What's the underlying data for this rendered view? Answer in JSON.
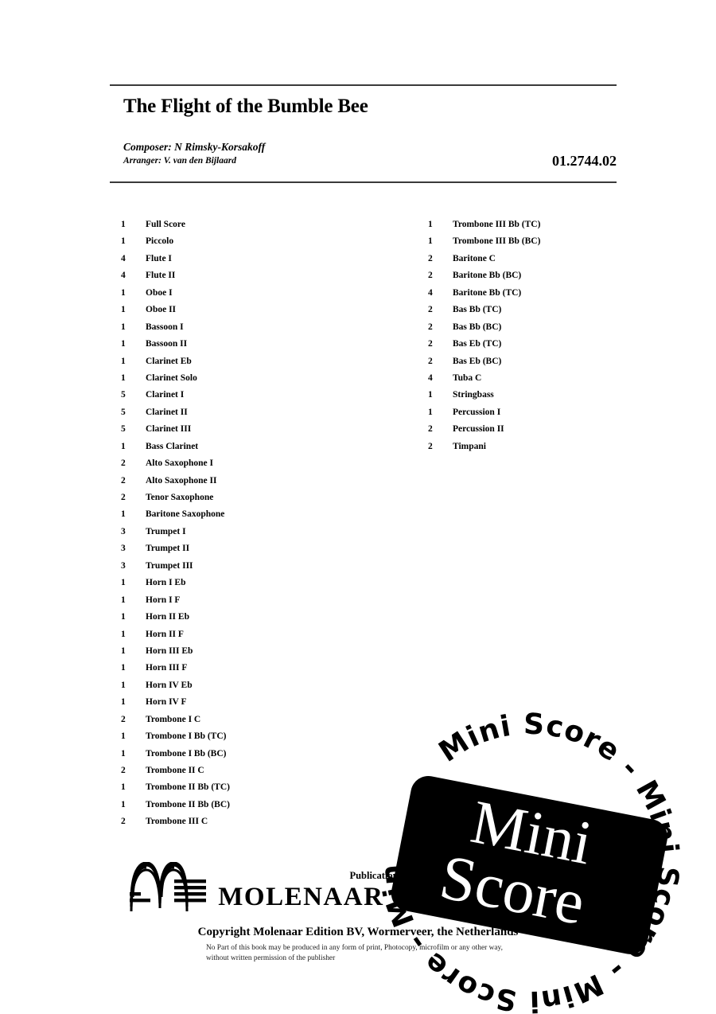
{
  "header": {
    "title": "The Flight of the Bumble Bee",
    "composer_label": "Composer: N Rimsky-Korsakoff",
    "arranger_label": "Arranger: V. van den Bijlaard",
    "catalog_number": "01.2744.02"
  },
  "instrumentation": {
    "left_column": [
      {
        "qty": "1",
        "name": "Full Score"
      },
      {
        "qty": "1",
        "name": "Piccolo"
      },
      {
        "qty": "4",
        "name": "Flute I"
      },
      {
        "qty": "4",
        "name": "Flute II"
      },
      {
        "qty": "1",
        "name": "Oboe I"
      },
      {
        "qty": "1",
        "name": "Oboe II"
      },
      {
        "qty": "1",
        "name": "Bassoon I"
      },
      {
        "qty": "1",
        "name": "Bassoon II"
      },
      {
        "qty": "1",
        "name": "Clarinet Eb"
      },
      {
        "qty": "1",
        "name": "Clarinet Solo"
      },
      {
        "qty": "5",
        "name": "Clarinet I"
      },
      {
        "qty": "5",
        "name": "Clarinet II"
      },
      {
        "qty": "5",
        "name": "Clarinet III"
      },
      {
        "qty": "1",
        "name": "Bass Clarinet"
      },
      {
        "qty": "2",
        "name": "Alto Saxophone I"
      },
      {
        "qty": "2",
        "name": "Alto Saxophone II"
      },
      {
        "qty": "2",
        "name": "Tenor Saxophone"
      },
      {
        "qty": "1",
        "name": "Baritone Saxophone"
      },
      {
        "qty": "3",
        "name": "Trumpet I"
      },
      {
        "qty": "3",
        "name": "Trumpet II"
      },
      {
        "qty": "3",
        "name": "Trumpet III"
      },
      {
        "qty": "1",
        "name": "Horn I Eb"
      },
      {
        "qty": "1",
        "name": "Horn I F"
      },
      {
        "qty": "1",
        "name": "Horn II Eb"
      },
      {
        "qty": "1",
        "name": "Horn II F"
      },
      {
        "qty": "1",
        "name": "Horn III Eb"
      },
      {
        "qty": "1",
        "name": "Horn III F"
      },
      {
        "qty": "1",
        "name": "Horn IV Eb"
      },
      {
        "qty": "1",
        "name": "Horn IV F"
      },
      {
        "qty": "2",
        "name": "Trombone I C"
      },
      {
        "qty": "1",
        "name": "Trombone I Bb (TC)"
      },
      {
        "qty": "1",
        "name": "Trombone I Bb (BC)"
      },
      {
        "qty": "2",
        "name": "Trombone II C"
      },
      {
        "qty": "1",
        "name": "Trombone II Bb (TC)"
      },
      {
        "qty": "1",
        "name": "Trombone II Bb (BC)"
      },
      {
        "qty": "2",
        "name": "Trombone III C"
      }
    ],
    "right_column": [
      {
        "qty": "1",
        "name": "Trombone III Bb (TC)"
      },
      {
        "qty": "1",
        "name": "Trombone III Bb (BC)"
      },
      {
        "qty": "2",
        "name": "Baritone C"
      },
      {
        "qty": "2",
        "name": "Baritone Bb (BC)"
      },
      {
        "qty": "4",
        "name": "Baritone Bb (TC)"
      },
      {
        "qty": "2",
        "name": "Bas Bb (TC)"
      },
      {
        "qty": "2",
        "name": "Bas Bb (BC)"
      },
      {
        "qty": "2",
        "name": "Bas Eb (TC)"
      },
      {
        "qty": "2",
        "name": "Bas Eb (BC)"
      },
      {
        "qty": "4",
        "name": "Tuba C"
      },
      {
        "qty": "1",
        "name": "Stringbass"
      },
      {
        "qty": "1",
        "name": "Percussion I"
      },
      {
        "qty": "2",
        "name": "Percussion II"
      },
      {
        "qty": "2",
        "name": "Timpani"
      }
    ]
  },
  "footer": {
    "publication_tag": "Publication",
    "publisher_wordmark": "MOLENAAR EDITION",
    "copyright_line": "Copyright Molenaar Edition BV, Wormerveer, the Netherlands",
    "fineprint_line1": "No Part of this book may be produced in any form of print, Photocopy, microfilm or any other way,",
    "fineprint_line2": "without written permission of the publisher"
  },
  "watermark": {
    "ring_text": "Mini Score - Mini Score - Mini Score - Mini Score - ",
    "band_line1": "Mini",
    "band_line2": "Score"
  },
  "colors": {
    "ink": "#000000",
    "rule": "#3a3a3a",
    "stamp_fill": "#000000",
    "stamp_text": "#ffffff"
  }
}
